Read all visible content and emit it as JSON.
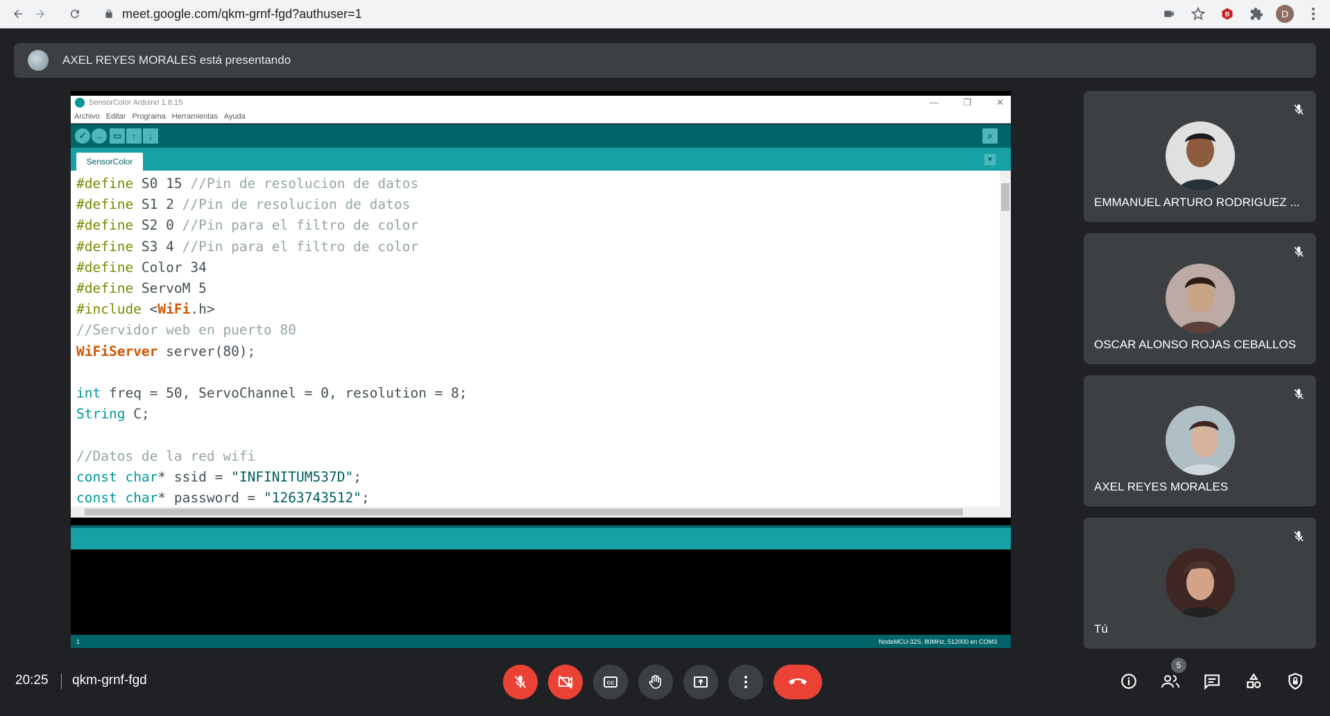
{
  "browser": {
    "url_host": "meet.google.com",
    "url_path": "/qkm-grnf-fgd?authuser=1",
    "profile_initial": "D",
    "icons": [
      "back-icon",
      "forward-icon",
      "reload-icon",
      "lock-icon",
      "camera-icon",
      "star-icon",
      "extension-b-icon",
      "puzzle-icon",
      "menu-icon"
    ]
  },
  "banner": {
    "text": "AXEL REYES MORALES está presentando"
  },
  "ide": {
    "title": "SensorColor Arduino 1.8.15",
    "menu": [
      "Archivo",
      "Editar",
      "Programa",
      "Herramientas",
      "Ayuda"
    ],
    "tab": "SensorColor",
    "line_number": "1",
    "board_info": "NodeMCU-32S, 80MHz, 512000 en COM3",
    "accent": "#00979c",
    "code_lines": [
      [
        {
          "t": "kw",
          "v": "#define"
        },
        {
          "t": "",
          "v": " S0 15 "
        },
        {
          "t": "cm",
          "v": "//Pin de resolucion de datos"
        }
      ],
      [
        {
          "t": "kw",
          "v": "#define"
        },
        {
          "t": "",
          "v": " S1 2 "
        },
        {
          "t": "cm",
          "v": "//Pin de resolucion de datos"
        }
      ],
      [
        {
          "t": "kw",
          "v": "#define"
        },
        {
          "t": "",
          "v": " S2 0 "
        },
        {
          "t": "cm",
          "v": "//Pin para el filtro de color"
        }
      ],
      [
        {
          "t": "kw",
          "v": "#define"
        },
        {
          "t": "",
          "v": " S3 4 "
        },
        {
          "t": "cm",
          "v": "//Pin para el filtro de color"
        }
      ],
      [
        {
          "t": "kw",
          "v": "#define"
        },
        {
          "t": "",
          "v": " Color 34"
        }
      ],
      [
        {
          "t": "kw",
          "v": "#define"
        },
        {
          "t": "",
          "v": " ServoM 5"
        }
      ],
      [
        {
          "t": "kw",
          "v": "#include"
        },
        {
          "t": "",
          "v": " <"
        },
        {
          "t": "cl",
          "v": "WiFi"
        },
        {
          "t": "",
          "v": ".h>"
        }
      ],
      [
        {
          "t": "cm",
          "v": "//Servidor web en puerto 80"
        }
      ],
      [
        {
          "t": "cl",
          "v": "WiFiServer"
        },
        {
          "t": "",
          "v": " server(80);"
        }
      ],
      [
        {
          "t": "",
          "v": ""
        }
      ],
      [
        {
          "t": "ty",
          "v": "int"
        },
        {
          "t": "",
          "v": " freq = 50, ServoChannel = 0, resolution = 8;"
        }
      ],
      [
        {
          "t": "ty",
          "v": "String"
        },
        {
          "t": "",
          "v": " C;"
        }
      ],
      [
        {
          "t": "",
          "v": ""
        }
      ],
      [
        {
          "t": "cm",
          "v": "//Datos de la red wifi"
        }
      ],
      [
        {
          "t": "ty",
          "v": "const"
        },
        {
          "t": "",
          "v": " "
        },
        {
          "t": "ty",
          "v": "char"
        },
        {
          "t": "",
          "v": "* ssid = "
        },
        {
          "t": "st",
          "v": "\"INFINITUM537D\""
        },
        {
          "t": "",
          "v": ";"
        }
      ],
      [
        {
          "t": "ty",
          "v": "const"
        },
        {
          "t": "",
          "v": " "
        },
        {
          "t": "ty",
          "v": "char"
        },
        {
          "t": "",
          "v": "* password = "
        },
        {
          "t": "st",
          "v": "\"1263743512\""
        },
        {
          "t": "",
          "v": ";"
        }
      ]
    ]
  },
  "participants": [
    {
      "name": "EMMANUEL ARTURO RODRIGUEZ ...",
      "avatar_color": "#5d4037",
      "muted": true
    },
    {
      "name": "OSCAR ALONSO ROJAS CEBALLOS",
      "avatar_color": "#8d6e63",
      "muted": true
    },
    {
      "name": "AXEL REYES MORALES",
      "avatar_color": "#9e9e9e",
      "muted": true
    },
    {
      "name": "Tú",
      "avatar_color": "#4e342e",
      "muted": true
    }
  ],
  "bottom_bar": {
    "time": "20:25",
    "meeting_code": "qkm-grnf-fgd",
    "participants_count": "5",
    "controls": [
      "mic-off-icon",
      "camera-off-icon",
      "captions-icon",
      "raise-hand-icon",
      "present-icon",
      "more-options-icon",
      "leave-call-icon"
    ],
    "right_icons": [
      "info-icon",
      "people-icon",
      "chat-icon",
      "activities-icon",
      "host-controls-icon"
    ]
  }
}
